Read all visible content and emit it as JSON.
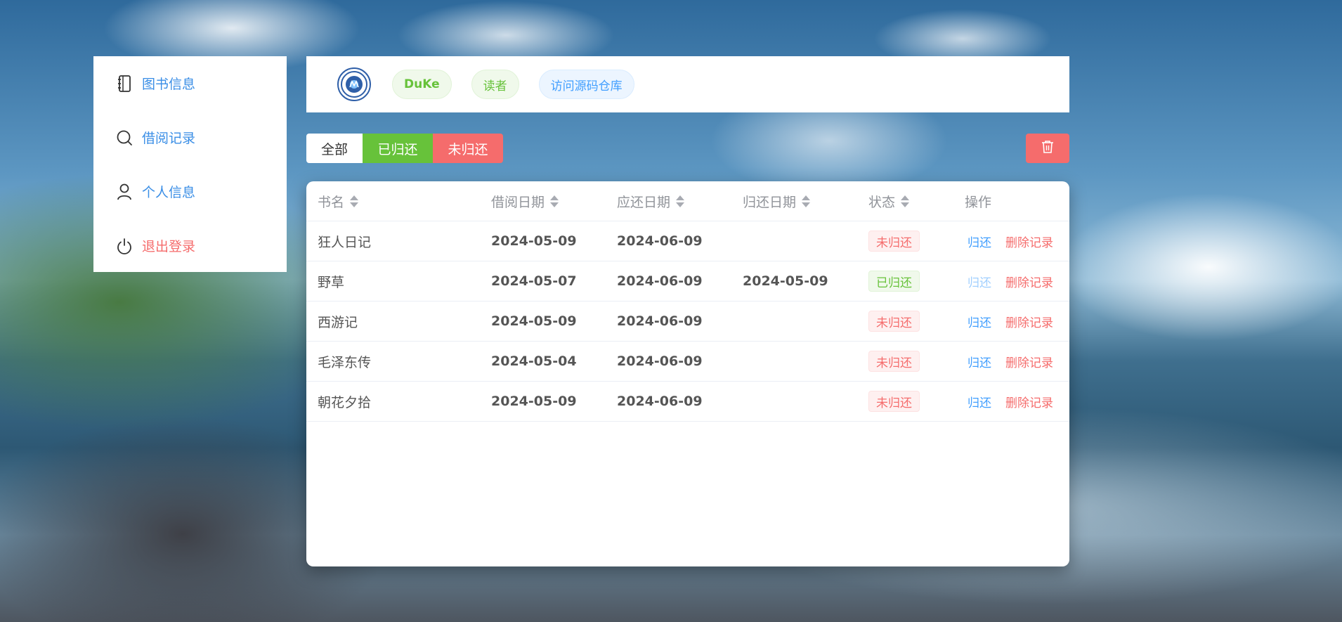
{
  "sidebar": {
    "items": [
      {
        "label": "图书信息",
        "icon": "notebook-icon"
      },
      {
        "label": "借阅记录",
        "icon": "search-icon"
      },
      {
        "label": "个人信息",
        "icon": "user-icon"
      },
      {
        "label": "退出登录",
        "icon": "power-icon"
      }
    ]
  },
  "header": {
    "logo_icon": "university-logo",
    "username": "DuKe",
    "role": "读者",
    "repo_link": "访问源码仓库"
  },
  "filters": {
    "all": "全部",
    "returned": "已归还",
    "unreturned": "未归还"
  },
  "toolbar": {
    "delete_icon": "trash-icon"
  },
  "table": {
    "columns": [
      "书名",
      "借阅日期",
      "应还日期",
      "归还日期",
      "状态",
      "操作"
    ],
    "rows": [
      {
        "name": "狂人日记",
        "borrow": "2024-05-09",
        "due": "2024-06-09",
        "returned": "",
        "status": "未归还",
        "return_label": "归还",
        "delete_label": "删除记录"
      },
      {
        "name": "野草",
        "borrow": "2024-05-07",
        "due": "2024-06-09",
        "returned": "2024-05-09",
        "status": "已归还",
        "return_label": "归还",
        "delete_label": "删除记录"
      },
      {
        "name": "西游记",
        "borrow": "2024-05-09",
        "due": "2024-06-09",
        "returned": "",
        "status": "未归还",
        "return_label": "归还",
        "delete_label": "删除记录"
      },
      {
        "name": "毛泽东传",
        "borrow": "2024-05-04",
        "due": "2024-06-09",
        "returned": "",
        "status": "未归还",
        "return_label": "归还",
        "delete_label": "删除记录"
      },
      {
        "name": "朝花夕拾",
        "borrow": "2024-05-09",
        "due": "2024-06-09",
        "returned": "",
        "status": "未归还",
        "return_label": "归还",
        "delete_label": "删除记录"
      }
    ]
  },
  "colors": {
    "primary": "#409eff",
    "success": "#67c23a",
    "danger": "#f56c6c"
  }
}
